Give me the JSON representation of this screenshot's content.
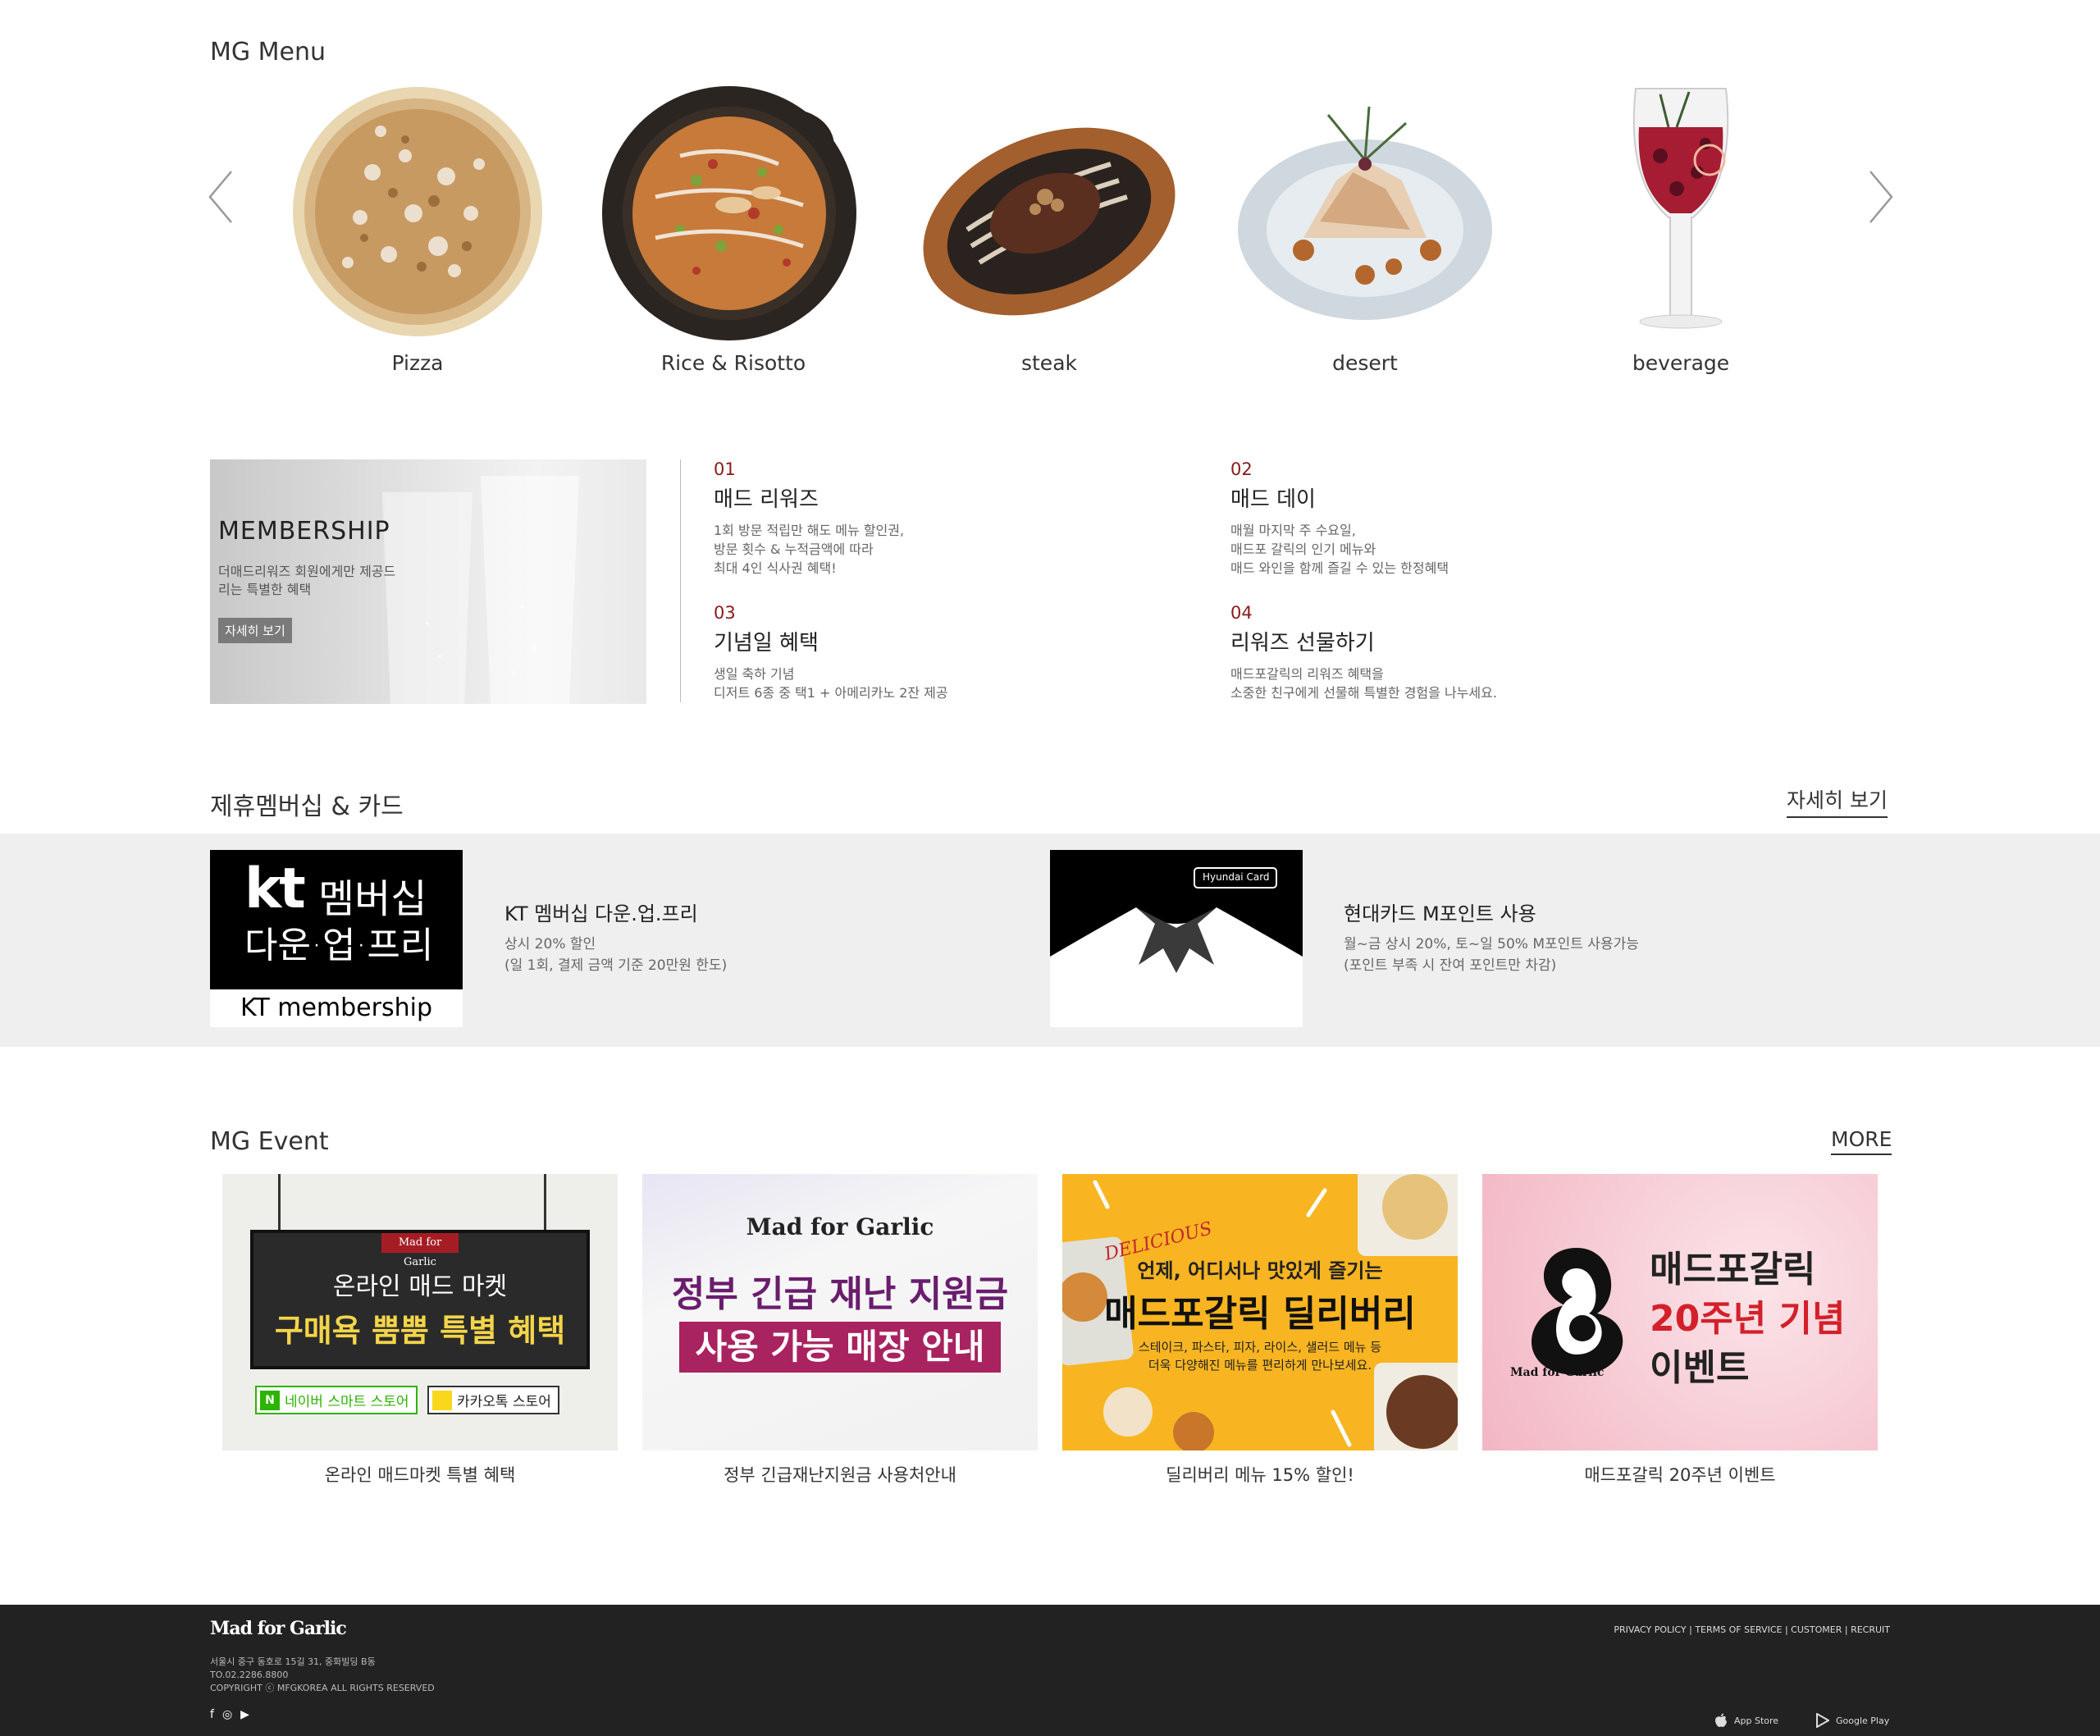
{
  "menu": {
    "title": "MG Menu",
    "items": [
      {
        "label": "Pizza",
        "icon": "pizza-photo"
      },
      {
        "label": "Rice & Risotto",
        "icon": "rice-skillet-photo"
      },
      {
        "label": "steak",
        "icon": "steak-platter-photo"
      },
      {
        "label": "desert",
        "icon": "dessert-plate-photo"
      },
      {
        "label": "beverage",
        "icon": "wine-glass-photo"
      }
    ]
  },
  "membership": {
    "banner_title": "MEMBERSHIP",
    "banner_desc": "더매드리워즈 회원에게만 제공드리는 특별한 혜택",
    "banner_button": "자세히 보기",
    "benefits": [
      {
        "num": "01",
        "title": "매드 리워즈",
        "desc": "1회 방문 적립만 해도 메뉴 할인권,\n방문 횟수 & 누적금액에 따라\n최대 4인 식사권 혜택!"
      },
      {
        "num": "02",
        "title": "매드 데이",
        "desc": "매월 마지막 주 수요일,\n매드포 갈릭의 인기 메뉴와\n매드 와인을 함께 즐길 수 있는 한정혜택"
      },
      {
        "num": "03",
        "title": "기념일 혜택",
        "desc": "생일 축하 기념\n디저트 6종 중 택1 + 아메리카노 2잔 제공"
      },
      {
        "num": "04",
        "title": "리워즈 선물하기",
        "desc": "매드포갈릭의 리워즈 혜택을\n소중한 친구에게 선물해 특별한 경험을 나누세요."
      }
    ]
  },
  "partner": {
    "title": "제휴멤버십 & 카드",
    "more": "자세히 보기",
    "cards": [
      {
        "img_kt": "kt",
        "img_main": "멤버십",
        "img_sub": "다운·업·프리",
        "img_caption": "KT membership",
        "title": "KT 멤버십 다운.업.프리",
        "desc": "상시 20% 할인\n(일 1회, 결제 금액 기준 20만원 한도)"
      },
      {
        "img_badge": "Hyundai Card",
        "title": "현대카드 M포인트 사용",
        "desc": "월~금 상시 20%, 토~일 50% M포인트 사용가능\n(포인트 부족 시 잔여 포인트만 차감)"
      }
    ]
  },
  "events": {
    "title": "MG Event",
    "more": "MORE",
    "items": [
      {
        "caption": "온라인 매드마켓 특별 혜택",
        "brand": "Mad for Garlic",
        "line1": "온라인 매드 마켓",
        "line2": "구매욕 뿜뿜 특별 혜택",
        "store1": "네이버 스마트 스토어",
        "store2": "카카오톡 스토어"
      },
      {
        "caption": "정부 긴급재난지원금 사용처안내",
        "brand": "Mad for Garlic",
        "line1": "정부 긴급 재난 지원금",
        "line2": "사용 가능 매장 안내"
      },
      {
        "caption": "딜리버리 메뉴 15% 할인!",
        "badge": "DELICIOUS",
        "line1": "언제, 어디서나 맛있게 즐기는",
        "line2": "매드포갈릭 딜리버리",
        "line3": "스테이크, 파스타, 피자, 라이스, 샐러드 메뉴 등",
        "line4": "더욱 다양해진 메뉴를 편리하게 만나보세요."
      },
      {
        "caption": "매드포갈릭 20주년 이벤트",
        "brand": "Mad for Garlic",
        "line1": "매드포갈릭",
        "line2": "20주년 기념",
        "line3": "이벤트"
      }
    ]
  },
  "footer": {
    "logo": "Mad for Garlic",
    "address": "서울시 중구 동호로 15길 31, 중화빌딩 B동",
    "tel": "TO.02.2286.8800",
    "copyright": "COPYRIGHT ⓒ MFGKOREA ALL RIGHTS RESERVED",
    "links": [
      "PRIVACY POLICY",
      "TERMS OF SERVICE",
      "CUSTOMER",
      "RECRUIT"
    ],
    "app_store": "App Store",
    "google_play": "Google Play"
  },
  "colors": {
    "accent_red": "#8b1a1a",
    "footer_bg": "#222222",
    "band_gray": "#efefef"
  }
}
